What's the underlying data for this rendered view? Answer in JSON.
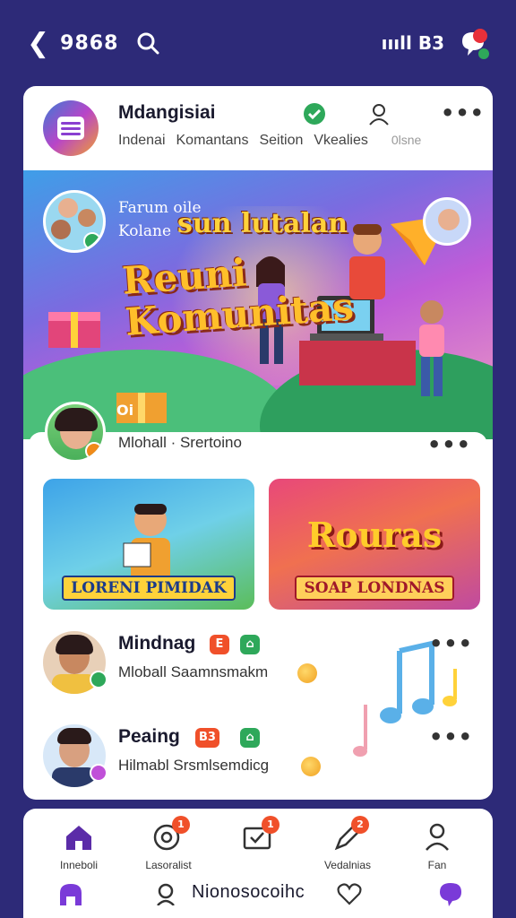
{
  "status_bar": {
    "time": "9868",
    "signal": "ıııll B3"
  },
  "app": {
    "title": "Mdangisiai",
    "tabs": [
      "Indenai",
      "Komantans",
      "Seition",
      "Vkealies",
      "0lsne"
    ]
  },
  "banner": {
    "small_line1": "Farum oile",
    "small_line2": "Kolane",
    "sun_text": "sun lutalan",
    "title_line1": "Reuni",
    "title_line2": "Komunitas",
    "gift_label": "Oi"
  },
  "post": {
    "author": "Mlohall · Srertoino",
    "tiles": [
      {
        "big": "",
        "label": "LORENI PIMIDAK"
      },
      {
        "big": "Rouras",
        "label": "SOAP LONDNAS"
      }
    ]
  },
  "list": [
    {
      "name": "Mindnag",
      "badge": "E",
      "sub": "Mloball  Saamnsmakm"
    },
    {
      "name": "Peaing",
      "badge": "B3",
      "sub": "Hilmabl  Srsmlsemdicg"
    }
  ],
  "bottom_nav": [
    {
      "label": "Inneboli",
      "icon": "home-icon",
      "badge": ""
    },
    {
      "label": "Lasoralist",
      "icon": "record-icon",
      "badge": "1"
    },
    {
      "label": "",
      "icon": "inbox-check-icon",
      "badge": "1"
    },
    {
      "label": "Vedalnias",
      "icon": "pen-icon",
      "badge": "2"
    },
    {
      "label": "Fan",
      "icon": "user-icon",
      "badge": ""
    }
  ],
  "bottom_bar": {
    "text": "Nionosocoihc"
  },
  "colors": {
    "background": "#2d2a78",
    "accent": "#5b2ca8",
    "badge_orange": "#f0502a",
    "green": "#2ea85a"
  }
}
